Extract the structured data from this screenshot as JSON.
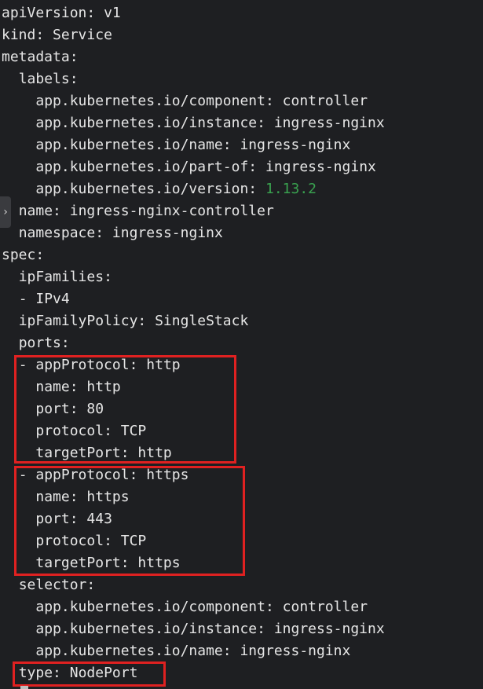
{
  "lines": [
    {
      "indent": "",
      "key": "apiVersion",
      "sep": ": ",
      "value": "v1"
    },
    {
      "indent": "",
      "key": "kind",
      "sep": ": ",
      "value": "Service"
    },
    {
      "indent": "",
      "key": "metadata",
      "sep": ":",
      "value": ""
    },
    {
      "indent": "  ",
      "key": "labels",
      "sep": ":",
      "value": ""
    },
    {
      "indent": "    ",
      "key": "app.kubernetes.io/component",
      "sep": ": ",
      "value": "controller"
    },
    {
      "indent": "    ",
      "key": "app.kubernetes.io/instance",
      "sep": ": ",
      "value": "ingress-nginx"
    },
    {
      "indent": "    ",
      "key": "app.kubernetes.io/name",
      "sep": ": ",
      "value": "ingress-nginx"
    },
    {
      "indent": "    ",
      "key": "app.kubernetes.io/part-of",
      "sep": ": ",
      "value": "ingress-nginx"
    },
    {
      "indent": "    ",
      "key": "app.kubernetes.io/version",
      "sep": ": ",
      "value": "1.13.2",
      "numeric": true
    },
    {
      "indent": "  ",
      "key": "name",
      "sep": ": ",
      "value": "ingress-nginx-controller"
    },
    {
      "indent": "  ",
      "key": "namespace",
      "sep": ": ",
      "value": "ingress-nginx"
    },
    {
      "indent": "",
      "key": "spec",
      "sep": ":",
      "value": ""
    },
    {
      "indent": "  ",
      "key": "ipFamilies",
      "sep": ":",
      "value": ""
    },
    {
      "indent": "  ",
      "key": "- IPv4",
      "sep": "",
      "value": ""
    },
    {
      "indent": "  ",
      "key": "ipFamilyPolicy",
      "sep": ": ",
      "value": "SingleStack"
    },
    {
      "indent": "  ",
      "key": "ports",
      "sep": ":",
      "value": ""
    },
    {
      "indent": "  ",
      "key": "- appProtocol",
      "sep": ": ",
      "value": "http"
    },
    {
      "indent": "    ",
      "key": "name",
      "sep": ": ",
      "value": "http"
    },
    {
      "indent": "    ",
      "key": "port",
      "sep": ": ",
      "value": "80"
    },
    {
      "indent": "    ",
      "key": "protocol",
      "sep": ": ",
      "value": "TCP"
    },
    {
      "indent": "    ",
      "key": "targetPort",
      "sep": ": ",
      "value": "http"
    },
    {
      "indent": "  ",
      "key": "- appProtocol",
      "sep": ": ",
      "value": "https"
    },
    {
      "indent": "    ",
      "key": "name",
      "sep": ": ",
      "value": "https"
    },
    {
      "indent": "    ",
      "key": "port",
      "sep": ": ",
      "value": "443"
    },
    {
      "indent": "    ",
      "key": "protocol",
      "sep": ": ",
      "value": "TCP"
    },
    {
      "indent": "    ",
      "key": "targetPort",
      "sep": ": ",
      "value": "https"
    },
    {
      "indent": "  ",
      "key": "selector",
      "sep": ":",
      "value": ""
    },
    {
      "indent": "    ",
      "key": "app.kubernetes.io/component",
      "sep": ": ",
      "value": "controller"
    },
    {
      "indent": "    ",
      "key": "app.kubernetes.io/instance",
      "sep": ": ",
      "value": "ingress-nginx"
    },
    {
      "indent": "    ",
      "key": "app.kubernetes.io/name",
      "sep": ": ",
      "value": "ingress-nginx"
    },
    {
      "indent": "  ",
      "key": "type",
      "sep": ": ",
      "value": "NodePort"
    }
  ],
  "gutter_handle_icon": "chevron-right-icon",
  "gutter_handle_glyph": "›",
  "colors": {
    "background": "#1e1f22",
    "text": "#e6e6e6",
    "number": "#39a14f",
    "highlight_box": "#e02121"
  }
}
